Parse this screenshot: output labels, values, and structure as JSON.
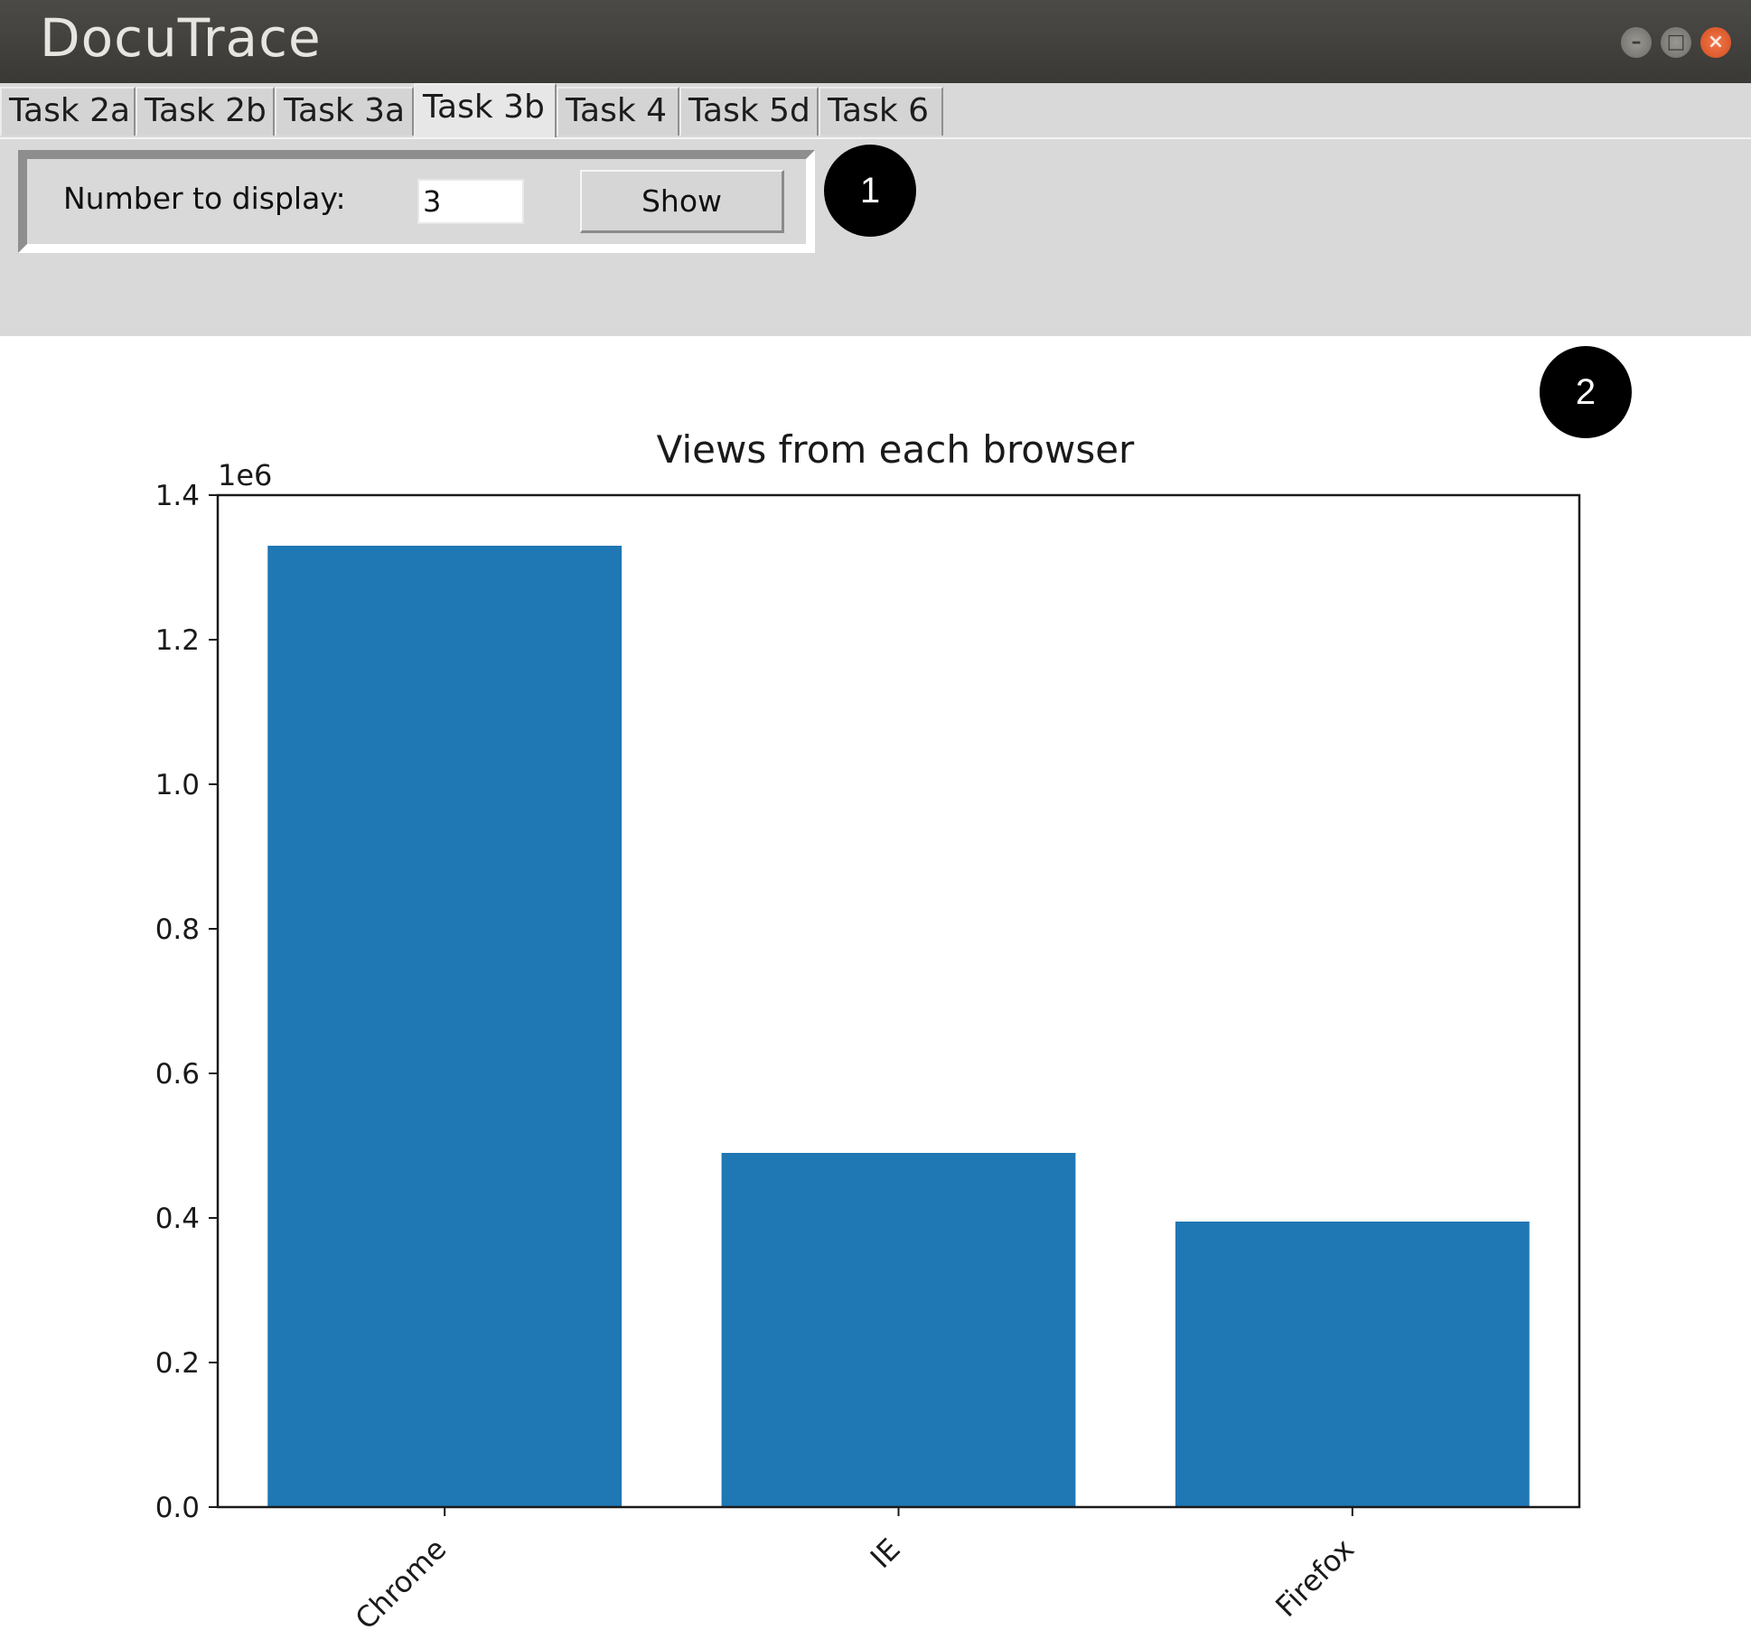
{
  "window": {
    "title": "DocuTrace",
    "controls": {
      "minimize": "–",
      "maximize": "□",
      "close": "×"
    }
  },
  "tabs": [
    {
      "label": "Task 2a",
      "active": false
    },
    {
      "label": "Task 2b",
      "active": false
    },
    {
      "label": "Task 3a",
      "active": false
    },
    {
      "label": "Task 3b",
      "active": true
    },
    {
      "label": "Task 4",
      "active": false
    },
    {
      "label": "Task 5d",
      "active": false
    },
    {
      "label": "Task 6",
      "active": false
    }
  ],
  "controls": {
    "number_label": "Number to display:",
    "number_value": "3",
    "show_label": "Show"
  },
  "markers": {
    "one": "1",
    "two": "2"
  },
  "chart_data": {
    "type": "bar",
    "title": "Views from each browser",
    "xlabel": "",
    "ylabel": "",
    "categories": [
      "Chrome",
      "IE",
      "Firefox"
    ],
    "values": [
      1330000,
      490000,
      395000
    ],
    "y_multiplier_label": "1e6",
    "ylim": [
      0,
      1.4
    ],
    "y_scale": 1000000,
    "yticks": [
      "0.0",
      "0.2",
      "0.4",
      "0.6",
      "0.8",
      "1.0",
      "1.2",
      "1.4"
    ],
    "tick_label_rotation": 45,
    "bar_color": "#1f77b4",
    "grid": false,
    "legend": "none"
  }
}
